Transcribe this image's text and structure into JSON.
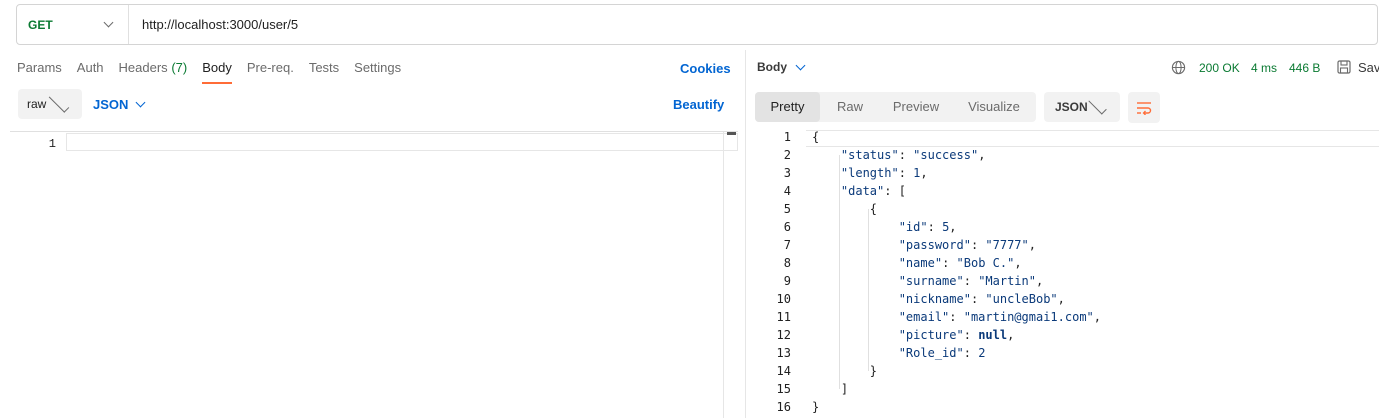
{
  "request": {
    "method": "GET",
    "url": "http://localhost:3000/user/5"
  },
  "request_tabs": {
    "params": "Params",
    "auth": "Auth",
    "headers": "Headers",
    "headers_count": "(7)",
    "body": "Body",
    "prereq": "Pre-req.",
    "tests": "Tests",
    "settings": "Settings",
    "cookies": "Cookies"
  },
  "body_options": {
    "mode": "raw",
    "format": "JSON",
    "beautify": "Beautify"
  },
  "request_editor": {
    "line_number": "1",
    "content": ""
  },
  "response_header": {
    "body_label": "Body",
    "status": "200 OK",
    "time": "4 ms",
    "size": "446 B",
    "save_label": "Sav"
  },
  "response_view": {
    "tabs": [
      "Pretty",
      "Raw",
      "Preview",
      "Visualize"
    ],
    "active_tab": "Pretty",
    "format": "JSON"
  },
  "response_lines": [
    {
      "n": "1",
      "t": "{"
    },
    {
      "n": "2",
      "t": "    \"status\": \"success\","
    },
    {
      "n": "3",
      "t": "    \"length\": 1,"
    },
    {
      "n": "4",
      "t": "    \"data\": ["
    },
    {
      "n": "5",
      "t": "        {"
    },
    {
      "n": "6",
      "t": "            \"id\": 5,"
    },
    {
      "n": "7",
      "t": "            \"password\": \"7777\","
    },
    {
      "n": "8",
      "t": "            \"name\": \"Bob C.\","
    },
    {
      "n": "9",
      "t": "            \"surname\": \"Martin\","
    },
    {
      "n": "10",
      "t": "            \"nickname\": \"uncleBob\","
    },
    {
      "n": "11",
      "t": "            \"email\": \"martin@gmai1.com\","
    },
    {
      "n": "12",
      "t": "            \"picture\": null,"
    },
    {
      "n": "13",
      "t": "            \"Role_id\": 2"
    },
    {
      "n": "14",
      "t": "        }"
    },
    {
      "n": "15",
      "t": "    ]"
    },
    {
      "n": "16",
      "t": "}"
    }
  ],
  "icons": {
    "method_dropdown": "chevron-down-icon",
    "globe": "globe-icon",
    "save": "save-icon",
    "wrap": "wrap-lines-icon"
  },
  "colors": {
    "accent": "#ff6c37",
    "link": "#0265d2",
    "success": "#0a7a32"
  }
}
